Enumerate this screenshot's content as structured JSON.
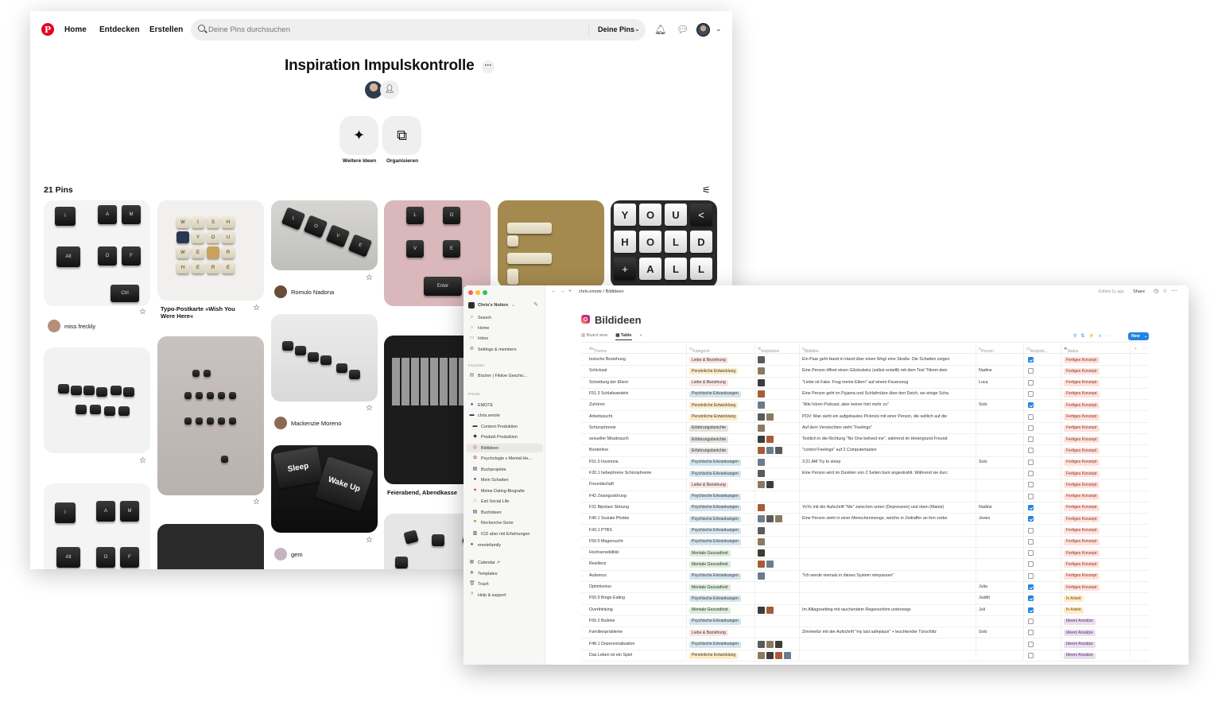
{
  "pinterest": {
    "nav": {
      "home": "Home",
      "discover": "Entdecken",
      "create": "Erstellen"
    },
    "search": {
      "placeholder": "Deine Pins durchsuchen",
      "scope": "Deine Pins"
    },
    "board": {
      "title": "Inspiration Impulskontrolle",
      "actions": {
        "ideas": "Weitere Ideen",
        "organize": "Organisieren"
      },
      "pin_count": "21 Pins"
    },
    "pins": {
      "col1": {
        "user": "miss freckly"
      },
      "col2": {
        "caption": "Typo-Postkarte »Wish You Were Here«"
      },
      "col3a": {
        "user": "Romulo Nadona"
      },
      "col3b": {
        "user": "Mackenzie Moreno"
      },
      "col3c": {
        "user": "gem"
      },
      "col4": {
        "caption": "Feierabend, Abendkasse"
      }
    },
    "keys": {
      "iamof": [
        "I",
        "A",
        "M",
        "Alt",
        "O",
        "F",
        "Ctrl"
      ],
      "wish": [
        "W",
        "I",
        "S",
        "H",
        "Y",
        "O",
        "U",
        "W",
        "E",
        "R",
        "E",
        "H",
        "E",
        "R",
        "E"
      ],
      "love": [
        "L",
        "O",
        "V",
        "E"
      ],
      "love2": [
        "L",
        "O",
        "V",
        "E",
        "Enter"
      ],
      "yha": [
        "Y",
        "O",
        "U",
        "<",
        "H",
        "O",
        "L",
        "D",
        "+",
        "A",
        "L",
        "L"
      ],
      "sleep": "Sleep",
      "wake": "Wake Up"
    }
  },
  "notion": {
    "workspace": "Chris's Notion",
    "sidebar": {
      "top": [
        "Search",
        "Home",
        "Inbox",
        "Settings & members"
      ],
      "favorites_label": "Favorites",
      "favorites": [
        "Bücher | Fiktive Geschic..."
      ],
      "private_label": "Private",
      "private": [
        "EMOTE",
        "chris.emote"
      ],
      "private_sub": [
        "Content Produktion",
        "Produkt Produktion",
        "Bildideen",
        "Psychologie x Mental He...",
        "Buchprojekte",
        "Mein Schatten",
        "Meine Dating-Biografie",
        "Exit Social Life",
        "Buchideen",
        "Recherche-Serie",
        "ICD aber mit Erfahrungen"
      ],
      "private_end": "emotefamily",
      "bottom": [
        "Calendar ↗",
        "Templates",
        "Trash",
        "Help & support"
      ]
    },
    "breadcrumb": {
      "parent": "chris.emote",
      "page": "Bildideen"
    },
    "edited": "Edited 1y ago",
    "share": "Share",
    "page_title": "Bildideen",
    "views": {
      "board": "Board view",
      "table": "Table"
    },
    "new_button": "New",
    "columns": [
      "Thema",
      "Kategorie",
      "Inspiration",
      "Bildidee",
      "Person",
      "Requisit...",
      "Status"
    ],
    "tag_colors": {
      "Liebe & Beziehung": "#fbe4e4",
      "Persönliche Entwicklung": "#fdecc8",
      "Psychische Erkrankungen": "#d3e5ef",
      "Erfahrungsberichte": "#e3e2e0",
      "Mentale Gesundheit": "#dbeddb",
      "Fertiges Konzept": "#ffe2dd",
      "In Arbeit": "#fdecc8",
      "Ideen/ Ansätze": "#e8deee"
    },
    "rows": [
      {
        "thema": "toxische Beziehung",
        "kategorie": "Liebe & Beziehung",
        "insp": 1,
        "bildidee": "Ein Paar geht Hand in Hand über einen Weg/ eine Straße. Die Schatten zeigen",
        "person": "",
        "req": true,
        "status": "Fertiges Konzept"
      },
      {
        "thema": "Schicksal",
        "kategorie": "Persönliche Entwicklung",
        "insp": 1,
        "bildidee": "Eine Person öffnet einen Glückskeks (selbst erstellt) mit dem Text \"Nimm dein",
        "person": "Nadine",
        "req": false,
        "status": "Fertiges Konzept"
      },
      {
        "thema": "Scheidung der Eltern",
        "kategorie": "Liebe & Beziehung",
        "insp": 1,
        "bildidee": "\"Liebe ist Fake. Frag meine Eltern\" auf einem Feuerzeug",
        "person": "Luca",
        "req": false,
        "status": "Fertiges Konzept"
      },
      {
        "thema": "F51.3 Schlafwandeln",
        "kategorie": "Psychische Erkrankungen",
        "insp": 1,
        "bildidee": "Eine Person geht im Pyjama und Schlafmütze über den Deich, wo einige Scha",
        "person": "",
        "req": false,
        "status": "Fertiges Konzept"
      },
      {
        "thema": "Zuhören",
        "kategorie": "Persönliche Entwicklung",
        "insp": 1,
        "bildidee": "\"Alle hören Podcast, aber keiner hört mehr zu\"",
        "person": "Solo",
        "req": true,
        "status": "Fertiges Konzept"
      },
      {
        "thema": "Arbeitssucht",
        "kategorie": "Persönliche Entwicklung",
        "insp": 2,
        "bildidee": "POV: Man sieht ein aufgebautes Picknick mit einer Person, die seitlich auf die",
        "person": "",
        "req": false,
        "status": "Fertiges Konzept"
      },
      {
        "thema": "Schizophrenie",
        "kategorie": "Erfahrungsberichte",
        "insp": 1,
        "bildidee": "Auf dem Verwischten steht \"Feelings\"",
        "person": "",
        "req": false,
        "status": "Fertiges Konzept"
      },
      {
        "thema": "sexueller Missbrauch",
        "kategorie": "Erfahrungsberichte",
        "insp": 2,
        "bildidee": "Textlich in die Richtung \"No One belived me\", während im Hintergrund Freund",
        "person": "",
        "req": false,
        "status": "Fertiges Konzept"
      },
      {
        "thema": "Borderline",
        "kategorie": "Erfahrungsberichte",
        "insp": 3,
        "bildidee": "\"control Feelings\" auf 2 Computertasten",
        "person": "",
        "req": false,
        "status": "Fertiges Konzept"
      },
      {
        "thema": "F51.0 Insomnia",
        "kategorie": "Psychische Erkrankungen",
        "insp": 1,
        "bildidee": "3:21 AM Try to sleep",
        "person": "Solo",
        "req": false,
        "status": "Fertiges Konzept"
      },
      {
        "thema": "F20.1 hebephrene Schizophrenie",
        "kategorie": "Psychische Erkrankungen",
        "insp": 1,
        "bildidee": "Eine Person wird im Dunklen von 2 Seiten bunt angestrahlt. Während sie durc",
        "person": "",
        "req": false,
        "status": "Fertiges Konzept"
      },
      {
        "thema": "Freundschaft",
        "kategorie": "Liebe & Beziehung",
        "insp": 2,
        "bildidee": "",
        "person": "",
        "req": false,
        "status": "Fertiges Konzept"
      },
      {
        "thema": "F42 Zwangsstörung",
        "kategorie": "Psychische Erkrankungen",
        "insp": 0,
        "bildidee": "",
        "person": "",
        "req": false,
        "status": "Fertiges Konzept"
      },
      {
        "thema": "F31 Bipolare Störung",
        "kategorie": "Psychische Erkrankungen",
        "insp": 1,
        "bildidee": "YoYo mit der Aufschrift \"Me\" zwischen unten (Depression) und oben (Manie)",
        "person": "Nadine",
        "req": true,
        "status": "Fertiges Konzept"
      },
      {
        "thema": "F40.1 Soziale Phobie",
        "kategorie": "Psychische Erkrankungen",
        "insp": 3,
        "bildidee": "Eine Person steht in einer Menschenmenge, welche in Zeitraffer an ihm vorbe",
        "person": "Jones",
        "req": true,
        "status": "Fertiges Konzept"
      },
      {
        "thema": "F43.1 PTBS",
        "kategorie": "Psychische Erkrankungen",
        "insp": 1,
        "bildidee": "",
        "person": "",
        "req": false,
        "status": "Fertiges Konzept"
      },
      {
        "thema": "F50.0 Magersucht",
        "kategorie": "Psychische Erkrankungen",
        "insp": 1,
        "bildidee": "",
        "person": "",
        "req": false,
        "status": "Fertiges Konzept"
      },
      {
        "thema": "Hochsensibilität",
        "kategorie": "Mentale Gesundheit",
        "insp": 1,
        "bildidee": "",
        "person": "",
        "req": false,
        "status": "Fertiges Konzept"
      },
      {
        "thema": "Resilienz",
        "kategorie": "Mentale Gesundheit",
        "insp": 2,
        "bildidee": "",
        "person": "",
        "req": false,
        "status": "Fertiges Konzept"
      },
      {
        "thema": "Autismus",
        "kategorie": "Psychische Erkrankungen",
        "insp": 1,
        "bildidee": "\"Ich werde niemals in dieses System reinpassen\"",
        "person": "",
        "req": false,
        "status": "Fertiges Konzept"
      },
      {
        "thema": "Optimismus",
        "kategorie": "Mentale Gesundheit",
        "insp": 0,
        "bildidee": "",
        "person": "Julia",
        "req": true,
        "status": "Fertiges Konzept"
      },
      {
        "thema": "F50.9 Binge Eating",
        "kategorie": "Psychische Erkrankungen",
        "insp": 0,
        "bildidee": "",
        "person": "Judith",
        "req": true,
        "status": "In Arbeit"
      },
      {
        "thema": "Overthinking",
        "kategorie": "Mentale Gesundheit",
        "insp": 2,
        "bildidee": "Im Alltagssetting mit rauchendem Regenschirm unterwegs",
        "person": "Juli",
        "req": true,
        "status": "In Arbeit"
      },
      {
        "thema": "F50.2 Bulimie",
        "kategorie": "Psychische Erkrankungen",
        "insp": 0,
        "bildidee": "",
        "person": "",
        "req": false,
        "status": "Ideen/ Ansätze"
      },
      {
        "thema": "Familienprobleme",
        "kategorie": "Liebe & Beziehung",
        "insp": 0,
        "bildidee": "Zimmertür mit der Aufschrift \"my last safeplace\" + leuchtender Türschlitz",
        "person": "Solo",
        "req": false,
        "status": "Ideen/ Ansätze"
      },
      {
        "thema": "F48.1 Depersonalisation",
        "kategorie": "Psychische Erkrankungen",
        "insp": 3,
        "bildidee": "",
        "person": "",
        "req": false,
        "status": "Ideen/ Ansätze"
      },
      {
        "thema": "Das Leben ist ein Spiel",
        "kategorie": "Persönliche Entwicklung",
        "insp": 4,
        "bildidee": "",
        "person": "",
        "req": false,
        "status": "Ideen/ Ansätze"
      }
    ]
  }
}
